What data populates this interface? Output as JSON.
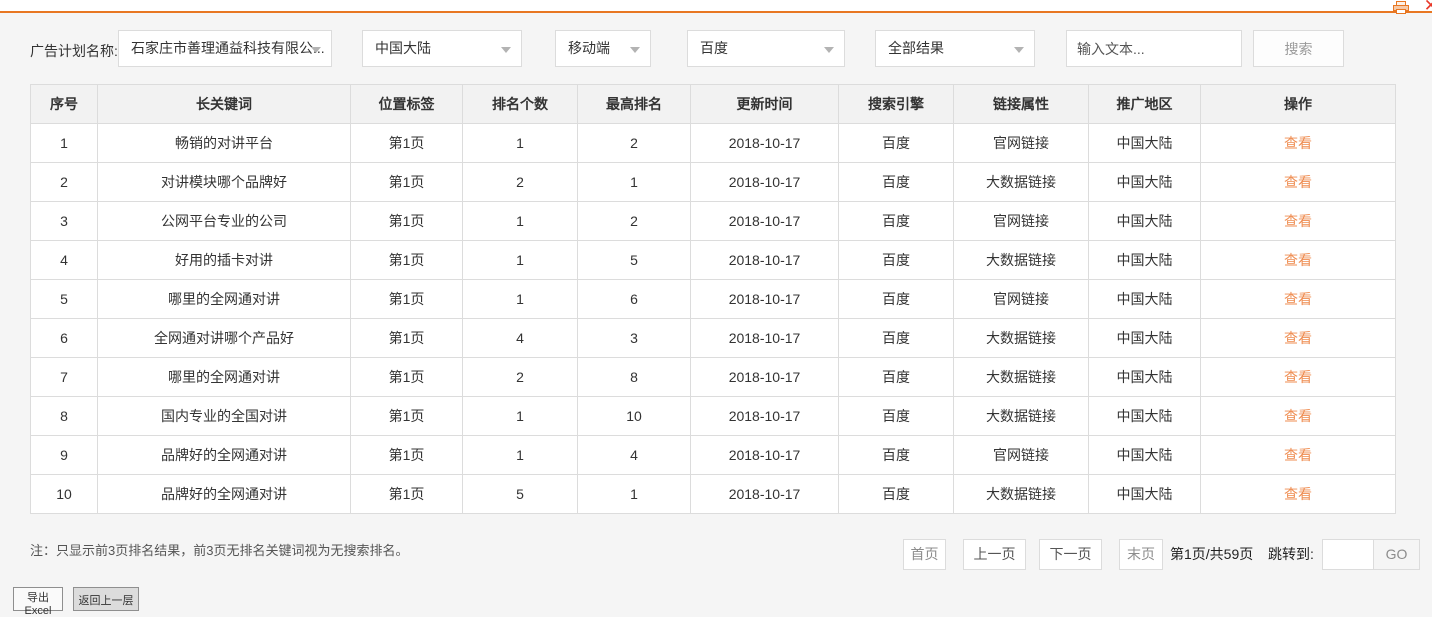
{
  "header": {
    "icons": {
      "print": "printer-icon",
      "close": "✕"
    }
  },
  "filters": {
    "label": "广告计划名称:",
    "plan": {
      "value": "石家庄市善理通益科技有限公..."
    },
    "region": {
      "value": "中国大陆"
    },
    "device": {
      "value": "移动端"
    },
    "engine": {
      "value": "百度"
    },
    "result": {
      "value": "全部结果"
    },
    "search_input": {
      "value": "",
      "placeholder": "输入文本..."
    },
    "search_button": "搜索"
  },
  "table": {
    "columns": [
      "序号",
      "长关键词",
      "位置标签",
      "排名个数",
      "最高排名",
      "更新时间",
      "搜索引擎",
      "链接属性",
      "推广地区",
      "操作"
    ],
    "action_label": "查看",
    "rows": [
      [
        "1",
        "畅销的对讲平台",
        "第1页",
        "1",
        "2",
        "2018-10-17",
        "百度",
        "官网链接",
        "中国大陆"
      ],
      [
        "2",
        "对讲模块哪个品牌好",
        "第1页",
        "2",
        "1",
        "2018-10-17",
        "百度",
        "大数据链接",
        "中国大陆"
      ],
      [
        "3",
        "公网平台专业的公司",
        "第1页",
        "1",
        "2",
        "2018-10-17",
        "百度",
        "官网链接",
        "中国大陆"
      ],
      [
        "4",
        "好用的插卡对讲",
        "第1页",
        "1",
        "5",
        "2018-10-17",
        "百度",
        "大数据链接",
        "中国大陆"
      ],
      [
        "5",
        "哪里的全网通对讲",
        "第1页",
        "1",
        "6",
        "2018-10-17",
        "百度",
        "官网链接",
        "中国大陆"
      ],
      [
        "6",
        "全网通对讲哪个产品好",
        "第1页",
        "4",
        "3",
        "2018-10-17",
        "百度",
        "大数据链接",
        "中国大陆"
      ],
      [
        "7",
        "哪里的全网通对讲",
        "第1页",
        "2",
        "8",
        "2018-10-17",
        "百度",
        "大数据链接",
        "中国大陆"
      ],
      [
        "8",
        "国内专业的全国对讲",
        "第1页",
        "1",
        "10",
        "2018-10-17",
        "百度",
        "大数据链接",
        "中国大陆"
      ],
      [
        "9",
        "品牌好的全网通对讲",
        "第1页",
        "1",
        "4",
        "2018-10-17",
        "百度",
        "官网链接",
        "中国大陆"
      ],
      [
        "10",
        "品牌好的全网通对讲",
        "第1页",
        "5",
        "1",
        "2018-10-17",
        "百度",
        "大数据链接",
        "中国大陆"
      ]
    ]
  },
  "note": "注：只显示前3页排名结果，前3页无排名关键词视为无搜索排名。",
  "pagination": {
    "first": "首页",
    "prev": "上一页",
    "next": "下一页",
    "last": "末页",
    "page_info": "第1页/共59页",
    "jump_label": "跳转到:",
    "go": "GO"
  },
  "footer_buttons": {
    "export": "导出Excel",
    "back": "返回上一层"
  },
  "colors": {
    "accent": "#e87722",
    "link": "#ef8c50",
    "close": "#e8392a"
  }
}
